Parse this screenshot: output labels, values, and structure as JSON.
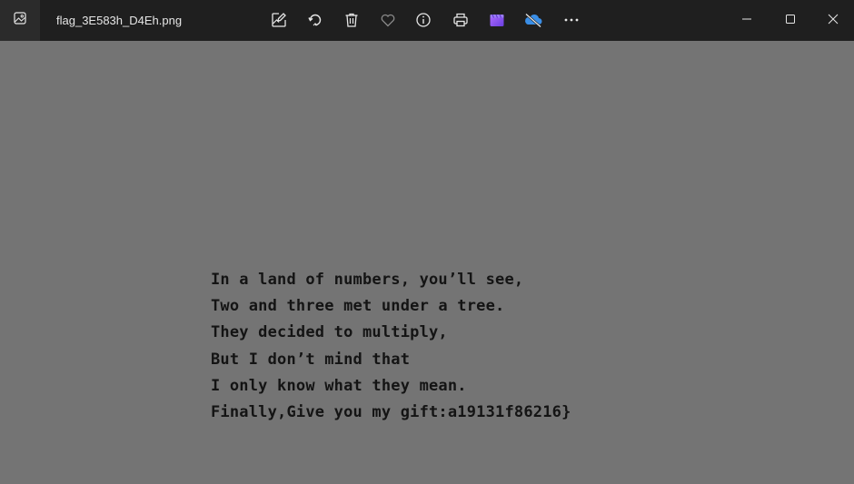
{
  "window": {
    "filename": "flag_3E583h_D4Eh.png"
  },
  "toolbar": {
    "icons": [
      "edit-icon",
      "rotate-icon",
      "delete-icon",
      "favorite-icon",
      "info-icon",
      "print-icon",
      "clipchamp-icon",
      "onedrive-icon",
      "more-icon"
    ]
  },
  "window_controls": [
    "minimize-icon",
    "maximize-icon",
    "close-icon"
  ],
  "colors": {
    "titlebar": "#1f1f1f",
    "canvas": "#747474",
    "text": "#141414",
    "accent_purple": "#8a5cf0",
    "accent_blue": "#3a8ee6"
  },
  "image_text": {
    "lines": [
      "In a land of numbers, you’ll see,",
      "Two and three met under a tree.",
      "They decided to multiply,",
      "But I don’t mind that",
      "I only know what they mean.",
      "Finally,Give you my gift:a19131f86216}"
    ]
  }
}
